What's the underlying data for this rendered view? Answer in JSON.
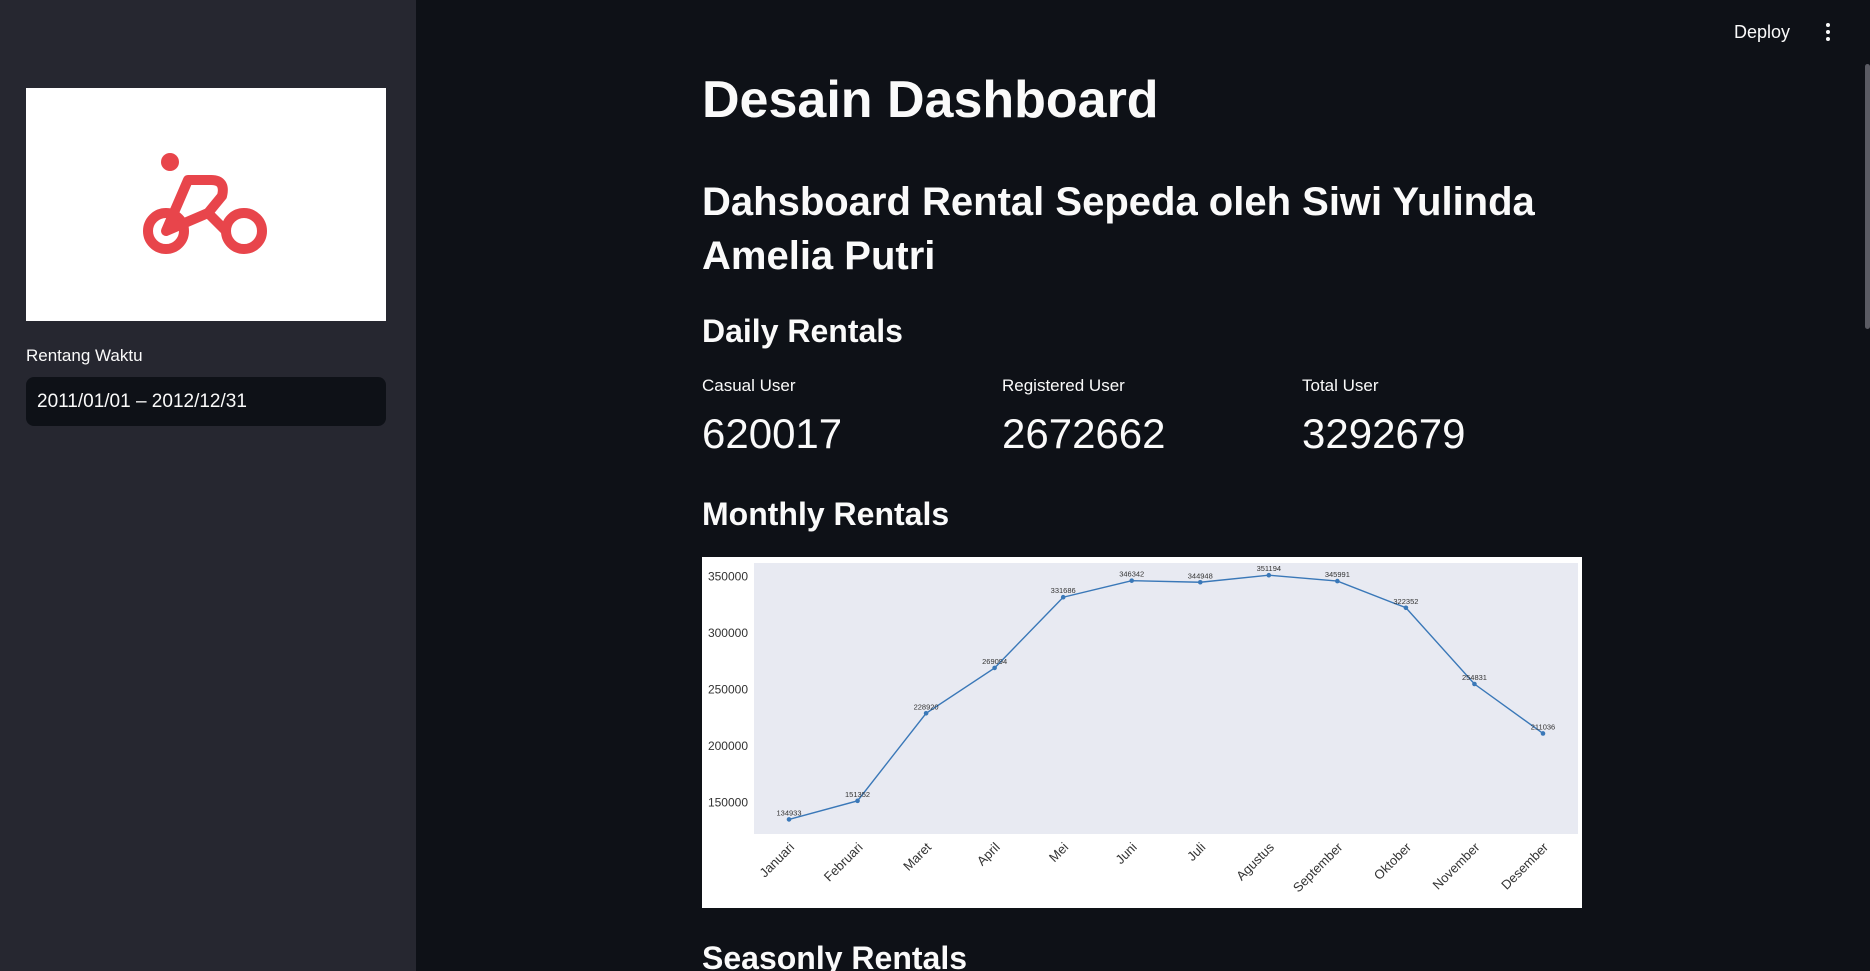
{
  "topbar": {
    "deploy_label": "Deploy",
    "menu_icon": "kebab-menu-icon"
  },
  "sidebar": {
    "logo_icon": "bicycle-logo-icon",
    "logo_color": "#e8454b",
    "range_label": "Rentang Waktu",
    "range_value": "2011/01/01 – 2012/12/31"
  },
  "main": {
    "title": "Desain Dashboard",
    "subtitle": "Dahsboard Rental Sepeda oleh Siwi Yulinda Amelia Putri",
    "daily_heading": "Daily Rentals",
    "metrics": [
      {
        "label": "Casual User",
        "value": "620017"
      },
      {
        "label": "Registered User",
        "value": "2672662"
      },
      {
        "label": "Total User",
        "value": "3292679"
      }
    ],
    "monthly_heading": "Monthly Rentals",
    "seasonly_heading": "Seasonly Rentals"
  },
  "chart_data": {
    "type": "line",
    "title": "",
    "xlabel": "",
    "ylabel": "",
    "categories": [
      "Januari",
      "Februari",
      "Maret",
      "April",
      "Mei",
      "Juni",
      "Juli",
      "Agustus",
      "September",
      "Oktober",
      "November",
      "Desember"
    ],
    "series": [
      {
        "values": [
          134933,
          151352,
          228920,
          269094,
          331686,
          346342,
          344948,
          351194,
          345991,
          322352,
          254831,
          211036
        ],
        "color": "#3a78b8"
      }
    ],
    "yticks": [
      150000,
      200000,
      250000,
      300000,
      350000
    ],
    "ylim": [
      122000,
      362000
    ],
    "grid": false,
    "background": "#e8eaf2",
    "point_labels": true
  }
}
